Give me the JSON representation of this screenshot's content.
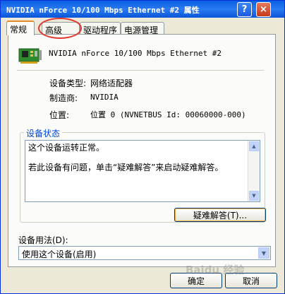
{
  "window": {
    "title": "NVIDIA nForce 10/100 Mbps Ethernet #2 属性",
    "help_label": "?",
    "close_label": "×"
  },
  "tabs": [
    {
      "label": "常规",
      "active": true
    },
    {
      "label": "高级",
      "active": false,
      "highlighted": true
    },
    {
      "label": "驱动程序",
      "active": false
    },
    {
      "label": "电源管理",
      "active": false
    }
  ],
  "highlight_color": "#e2362f",
  "device": {
    "icon": "network-card-icon",
    "name": "NVIDIA nForce 10/100 Mbps Ethernet #2"
  },
  "info": {
    "type_label": "设备类型:",
    "type_value": "网络适配器",
    "manufacturer_label": "制造商:",
    "manufacturer_value": "NVIDIA",
    "location_label": "位置:",
    "location_value": "位置 0 (NVNETBUS Id: 00060000-000)"
  },
  "status": {
    "group_label": "设备状态",
    "line1": "这个设备运转正常。",
    "line2": "若此设备有问题，单击“疑难解答”来启动疑难解答。",
    "troubleshoot_label": "疑难解答(T)..."
  },
  "usage": {
    "label": "设备用法(D):",
    "selected": "使用这个设备(启用)"
  },
  "buttons": {
    "ok": "确定",
    "cancel": "取消"
  },
  "watermark": "Baidu 经验"
}
